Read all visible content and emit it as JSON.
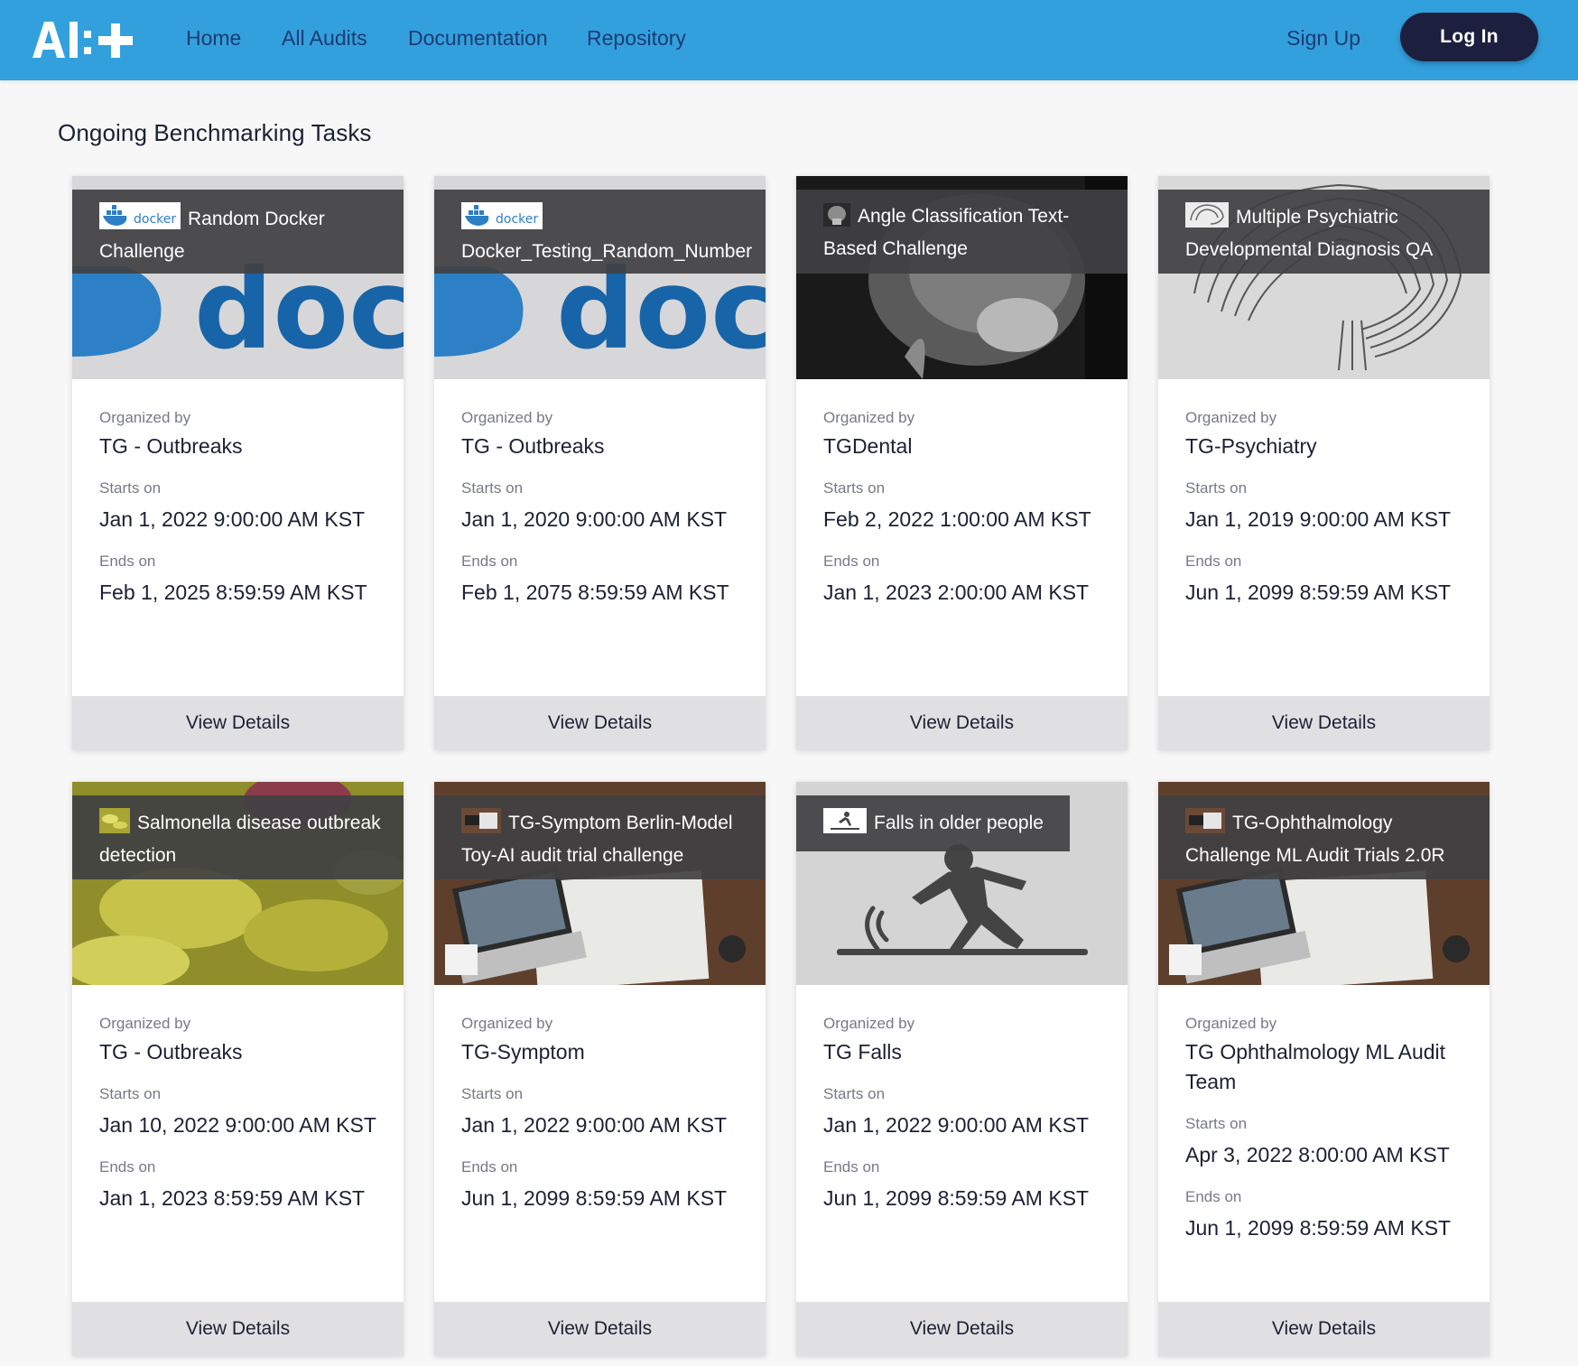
{
  "nav": {
    "logo_text": "AI:+",
    "links": [
      "Home",
      "All Audits",
      "Documentation",
      "Repository"
    ],
    "signup_label": "Sign Up",
    "login_label": "Log In",
    "colors": {
      "bar": "#32a0dd",
      "link": "#1d3b73",
      "login_bg": "#1c1f3e"
    }
  },
  "page": {
    "section_title": "Ongoing Benchmarking Tasks"
  },
  "labels": {
    "organized_by": "Organized by",
    "starts_on": "Starts on",
    "ends_on": "Ends on",
    "view_details": "View Details"
  },
  "cards": [
    {
      "title": "Random Docker Challenge",
      "icon": "docker-logo-icon",
      "organizer": "TG - Outbreaks",
      "starts": "Jan 1, 2022 9:00:00 AM KST",
      "ends": "Feb 1, 2025 8:59:59 AM KST"
    },
    {
      "title": "Docker_Testing_Random_Number",
      "icon": "docker-logo-icon",
      "organizer": "TG - Outbreaks",
      "starts": "Jan 1, 2020 9:00:00 AM KST",
      "ends": "Feb 1, 2075 8:59:59 AM KST"
    },
    {
      "title": "Angle Classification Text-Based Challenge",
      "icon": "skull-xray-icon",
      "organizer": "TGDental",
      "starts": "Feb 2, 2022 1:00:00 AM KST",
      "ends": "Jan 1, 2023 2:00:00 AM KST"
    },
    {
      "title": "Multiple Psychiatric Developmental Diagnosis QA",
      "icon": "brain-icon",
      "organizer": "TG-Psychiatry",
      "starts": "Jan 1, 2019 9:00:00 AM KST",
      "ends": "Jun 1, 2099 8:59:59 AM KST"
    },
    {
      "title": "Salmonella disease outbreak detection",
      "icon": "bacteria-icon",
      "organizer": "TG - Outbreaks",
      "starts": "Jan 10, 2022 9:00:00 AM KST",
      "ends": "Jan 1, 2023 8:59:59 AM KST"
    },
    {
      "title": "TG-Symptom Berlin-Model Toy-AI audit trial challenge",
      "icon": "laptop-map-icon",
      "organizer": "TG-Symptom",
      "starts": "Jan 1, 2022 9:00:00 AM KST",
      "ends": "Jun 1, 2099 8:59:59 AM KST"
    },
    {
      "title": "Falls in older people",
      "icon": "person-falling-icon",
      "organizer": "TG Falls",
      "starts": "Jan 1, 2022 9:00:00 AM KST",
      "ends": "Jun 1, 2099 8:59:59 AM KST"
    },
    {
      "title": "TG-Ophthalmology Challenge ML Audit Trials 2.0R",
      "icon": "laptop-map-icon",
      "organizer": "TG Ophthalmology ML Audit Team",
      "starts": "Apr 3, 2022 8:00:00 AM KST",
      "ends": "Jun 1, 2099 8:59:59 AM KST"
    }
  ]
}
